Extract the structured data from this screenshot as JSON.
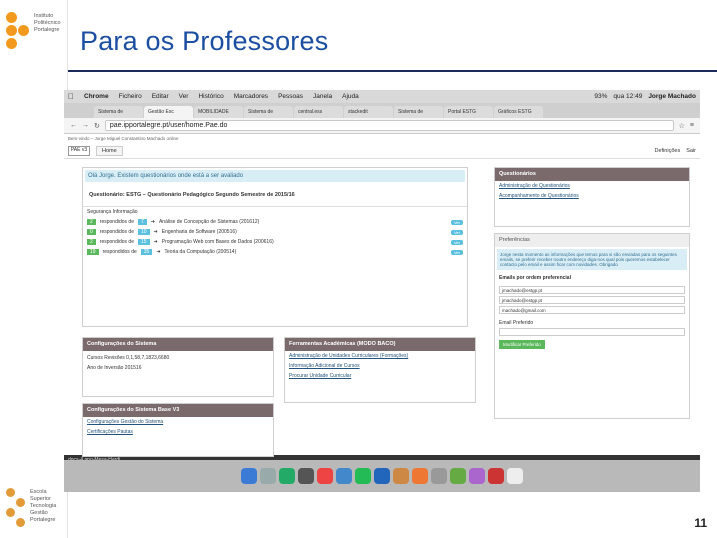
{
  "slide": {
    "title": "Para os Professores",
    "page_number": "11"
  },
  "logos": {
    "top_text": [
      "Instituto",
      "Politécnico",
      "Portalegre"
    ],
    "bottom_text": [
      "Escola",
      "Superior",
      "Tecnologia",
      "Gestão",
      "Portalegre"
    ]
  },
  "mac": {
    "menus": [
      "Chrome",
      "Ficheiro",
      "Editar",
      "Ver",
      "Histórico",
      "Marcadores",
      "Pessoas",
      "Janela",
      "Ajuda"
    ],
    "battery": "93%",
    "time": "qua 12:49",
    "user": "Jorge Machado"
  },
  "tabs": [
    "Sistema de",
    "Gestão Esc",
    "MOBILIDADE",
    "Sistema de",
    "central.ess",
    "stackedit",
    "Sistema de",
    "Portal ESTG",
    "Gráficos ESTG"
  ],
  "url": "pae.ipportalegre.pt/user/home.Pae.do",
  "crumb": "Bem-vindo – Jorge Miguel Constantino Machado online",
  "nav": {
    "logo": "PAE v3",
    "home": "Home",
    "settings": "Definições",
    "logout": "Sair"
  },
  "alert": "Olá Jorge. Existem questionários onde está a ser avaliado",
  "questionario": "Questionário: ESTG – Questionário Pedagógico Segundo Semestre de 2015/16",
  "seguranca": "Segurança Informação",
  "rows": [
    {
      "a": "2",
      "label": "respondidos de",
      "b": "7",
      "course": "Análise de Concepção de Sistemas (201612)"
    },
    {
      "a": "0",
      "label": "respondidos de",
      "b": "10",
      "course": "Engenharia de Software (200516)"
    },
    {
      "a": "2",
      "label": "respondidos de",
      "b": "15",
      "course": "Programação Web com Bases de Dados (200616)"
    },
    {
      "a": "19",
      "label": "respondidos de",
      "b": "35",
      "course": "Teoria da Computação (200514)"
    }
  ],
  "view": "Ver",
  "config_sistema": {
    "title": "Configurações do Sistema",
    "lines": [
      "Cursos Revisões 0,1,58,7,1823,6680",
      "Ano de Inversão 201516"
    ]
  },
  "config_base": {
    "title": "Configurações do Sistema Base V3",
    "links": [
      "Configurações Gestão do Sistema",
      "Certificações Pautas"
    ]
  },
  "ferramentas": {
    "title": "Ferramentas Académicas (MODO BACO)",
    "links": [
      "Administração de Unidades Curriculares (Formações)",
      "Informação Adicional de Cursos",
      "Procurar Unidade Curricular"
    ]
  },
  "questionarios": {
    "title": "Questionários",
    "links": [
      "Administração de Questionários",
      "Acompanhamento de Questionários"
    ]
  },
  "preferencias": {
    "title": "Preferências",
    "info": "Jorge nesta momento as informações que temos para si são enviadas para os seguintes emails, se preferir receber noutro endereço diga-nos qual pois queremos estabelecer contacto pelo email e assim ficar com novidades. Obrigado",
    "emails_title": "Emails por ordem preferencial",
    "emails": [
      "jmachado@estgp.pt",
      "jmachado@estgp.pt",
      "machado@gmail.com"
    ],
    "pref_label": "Email Preferido",
    "btn": "Modificar Preferido"
  },
  "status": "docs-4.ano-Mesa-Hardi...",
  "colors": {
    "accent": "#1c4ea1",
    "header": "#7a6a6c",
    "orange": "#f39a1e"
  }
}
